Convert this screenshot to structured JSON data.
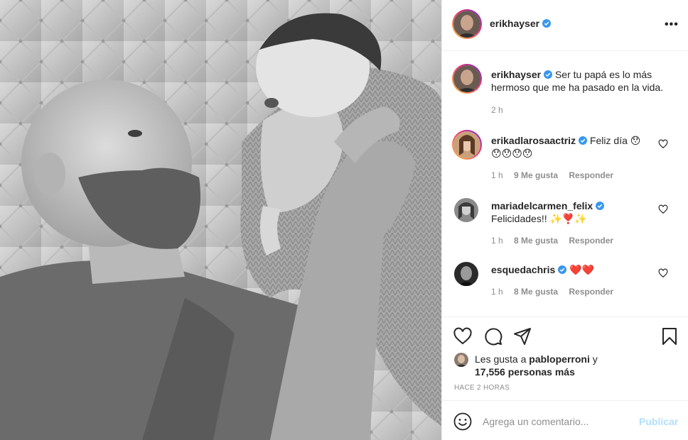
{
  "post": {
    "author": "erikhayser",
    "image_icon": "photo-father-baby"
  },
  "header": {
    "username": "erikhayser",
    "more_label": "•••"
  },
  "caption": {
    "username": "erikhayser",
    "text": "Ser tu papá es lo más hermoso que me ha pasado en la vida.",
    "time": "2 h"
  },
  "comments": [
    {
      "username": "erikadlarosaactriz",
      "text": "Feliz día 😯",
      "text2": "😯😯😯😯",
      "time": "1 h",
      "likes": "9 Me gusta",
      "reply": "Responder"
    },
    {
      "username": "mariadelcarmen_felix",
      "text": "Felicidades!! ✨❣️✨",
      "time": "1 h",
      "likes": "8 Me gusta",
      "reply": "Responder"
    },
    {
      "username": "esquedachris",
      "text": "❤️❤️",
      "time": "1 h",
      "likes": "8 Me gusta",
      "reply": "Responder"
    }
  ],
  "likes": {
    "prefix": "Les gusta a",
    "user": "pabloperroni",
    "suffix": "y",
    "count": "17,556 personas más"
  },
  "time_ago": "HACE 2 HORAS",
  "add_comment": {
    "placeholder": "Agrega un comentario...",
    "publish_label": "Publicar"
  },
  "colors": {
    "verified": "#3897f0",
    "publish_disabled": "#b2dffc",
    "muted": "#8e8e8e",
    "heart_red": "#d0021b"
  }
}
